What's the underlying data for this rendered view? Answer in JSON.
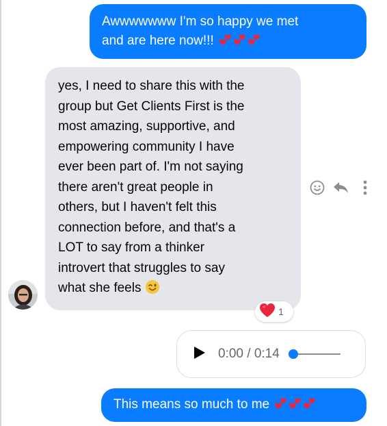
{
  "messages": {
    "sent_top": {
      "line1": "Awwwwwww I'm so happy we met",
      "line2": "and are here now!!!",
      "emoji": "two-hearts-icon"
    },
    "received": {
      "lines": [
        "yes, I need to share this with the",
        "group but Get Clients First is the",
        "most amazing, supportive, and",
        "empowering community I have",
        "ever been part of. I'm not saying",
        "there aren't great people in",
        "others, but I haven't felt this",
        "connection before, and that's a",
        "LOT to say from a thinker",
        "introvert that struggles to say",
        "what she feels"
      ],
      "emoji": "winking-face-icon",
      "reaction": {
        "emoji": "red-heart-icon",
        "count": "1"
      }
    },
    "audio": {
      "time": "0:00 / 0:14",
      "progress": 0.0
    },
    "sent_bottom": {
      "text": "This means so much to me",
      "emoji": "two-hearts-icon"
    }
  },
  "message_actions": [
    "react-icon",
    "reply-icon",
    "more-options-icon"
  ],
  "colors": {
    "sent_bubble": "#0a7cff",
    "received_bubble": "#e4e6eb",
    "heart": "#e8263d",
    "text_secondary": "#65676b"
  }
}
